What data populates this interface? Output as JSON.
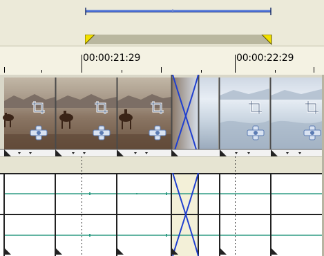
{
  "timeline": {
    "ruler": {
      "marks": [
        {
          "label": "00:00:21:29"
        },
        {
          "label": "00:00:22:29"
        }
      ]
    }
  },
  "video_track": {
    "clips": [
      {
        "name": "horse-rider",
        "icons": [
          "crop-icon",
          "pan-zoom-icon"
        ]
      },
      {
        "name": "snow-field",
        "icons": [
          "crop-icon",
          "pan-zoom-icon"
        ]
      }
    ],
    "transition": "crossfade"
  },
  "audio_track": {
    "lanes": 2
  },
  "colors": {
    "background": "#ecead9",
    "selection_bar": "#4a6fd8",
    "loop_region": "#b9b79f",
    "loop_marker": "#f2e000",
    "envelope": "#2e9c84",
    "transition": "#1f3fd0"
  }
}
